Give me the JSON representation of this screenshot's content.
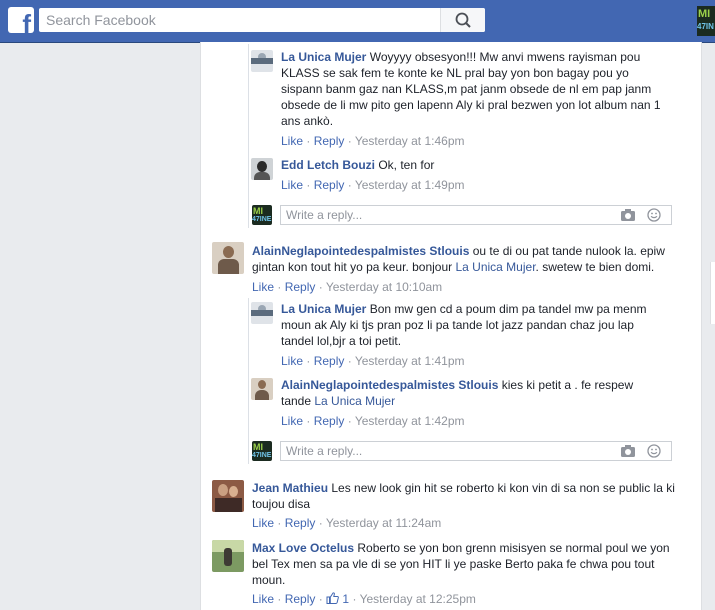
{
  "header": {
    "search_placeholder": "Search Facebook",
    "logo_letter": "f",
    "corner_avatar_text_top": "MI",
    "corner_avatar_text_bottom": "47IN"
  },
  "avatar_badge": {
    "top": "MI",
    "bottom": "47INE"
  },
  "labels": {
    "like": "Like",
    "reply": "Reply",
    "dot": "·",
    "write_reply_placeholder": "Write a reply..."
  },
  "thread1_replies": [
    {
      "author": "La Unica Mujer",
      "text": "Woyyyy obsesyon!!! Mw anvi mwens rayisman pou KLASS se sak fem te konte ke NL pral bay yon bon bagay pou yo sispann banm gaz nan KLASS,m pat janm obsede de nl em pap janm obsede de li mw pito gen lapenn Aly ki pral bezwen yon lot album nan 1 ans ankò.",
      "time": "Yesterday at 1:46pm"
    },
    {
      "author": "Edd Letch Bouzi",
      "text": "Ok, ten for",
      "time": "Yesterday at 1:49pm"
    }
  ],
  "comment_alain": {
    "author": "AlainNeglapointedespalmistes Stlouis",
    "text_before": "ou te di ou pat tande nulook la. epiw gintan kon tout hit yo pa keur. bonjour",
    "mention": "La Unica Mujer",
    "text_after": ". swetew te bien domi.",
    "time": "Yesterday at 10:10am"
  },
  "thread2_replies": [
    {
      "author": "La Unica Mujer",
      "text": "Bon mw gen cd a poum dim pa tandel mw pa menm moun ak Aly ki tjs pran poz li pa tande lot jazz pandan chaz jou lap tandel lol,bjr a toi petit.",
      "time": "Yesterday at 1:41pm"
    },
    {
      "author": "AlainNeglapointedespalmistes Stlouis",
      "text": "kies ki petit a . fe respew tande",
      "mention": "La Unica Mujer",
      "time": "Yesterday at 1:42pm"
    }
  ],
  "comment_jean": {
    "author": "Jean Mathieu",
    "text": "Les new look gin hit se roberto ki kon vin di sa non se public la ki toujou disa",
    "time": "Yesterday at 11:24am"
  },
  "comment_max": {
    "author": "Max Love Octelus",
    "text": "Roberto se yon bon grenn misisyen se normal poul we yon bel Tex men sa pa vle di se yon HIT li ye paske Berto paka fe chwa pou tout moun.",
    "like_count": "1",
    "time": "Yesterday at 12:25pm"
  },
  "colors": {
    "header_blue": "#4267b2",
    "link_blue": "#365899",
    "meta_gray": "#90949c",
    "page_bg": "#e9ebee"
  }
}
